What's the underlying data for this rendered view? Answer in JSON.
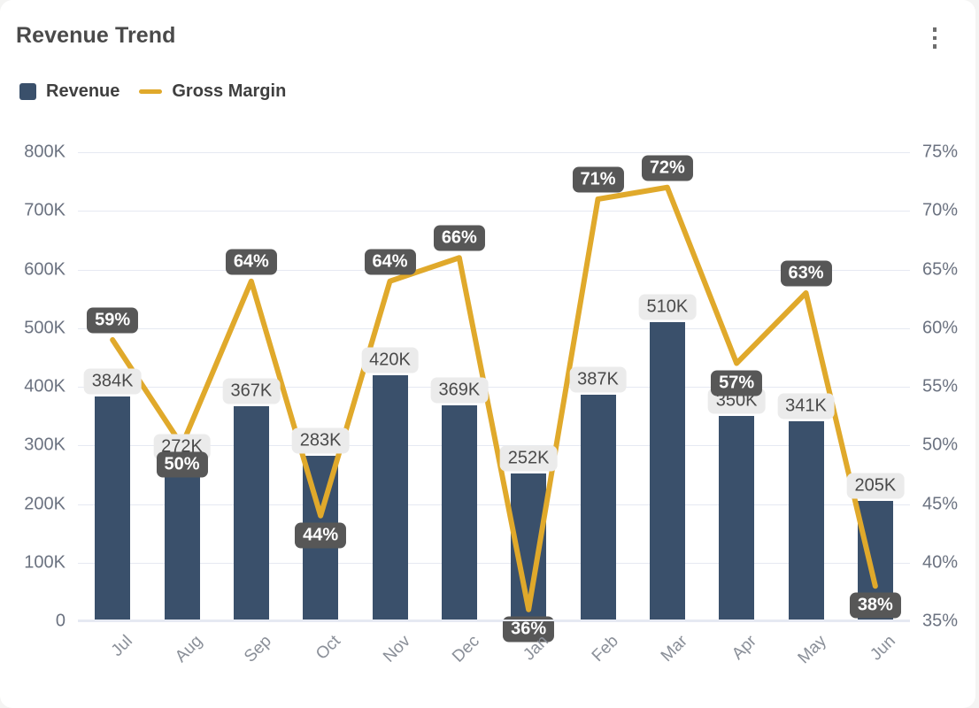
{
  "header": {
    "title": "Revenue Trend",
    "menu_icon": "kebab-menu-icon"
  },
  "legend": {
    "position": "top-left",
    "items": [
      {
        "label": "Revenue",
        "color": "#3a506b",
        "marker": "square"
      },
      {
        "label": "Gross Margin",
        "color": "#e0a92b",
        "marker": "line"
      }
    ]
  },
  "chart_data": {
    "type": "bar",
    "title": "Revenue Trend",
    "xlabel": "",
    "ylabel": "",
    "grid": true,
    "categories": [
      "Jul",
      "Aug",
      "Sep",
      "Oct",
      "Nov",
      "Dec",
      "Jan",
      "Feb",
      "Mar",
      "Apr",
      "May",
      "Jun"
    ],
    "series": [
      {
        "name": "Revenue",
        "type": "bar",
        "axis": "left",
        "color": "#3a506b",
        "values": [
          384000,
          272000,
          367000,
          283000,
          420000,
          369000,
          252000,
          387000,
          510000,
          350000,
          341000,
          205000
        ],
        "labels": [
          "384K",
          "272K",
          "367K",
          "283K",
          "420K",
          "369K",
          "252K",
          "387K",
          "510K",
          "350K",
          "341K",
          "205K"
        ]
      },
      {
        "name": "Gross Margin",
        "type": "line",
        "axis": "right",
        "color": "#e0a92b",
        "values": [
          59,
          50,
          64,
          44,
          64,
          66,
          36,
          71,
          72,
          57,
          63,
          38
        ],
        "labels": [
          "59%",
          "50%",
          "64%",
          "44%",
          "64%",
          "66%",
          "36%",
          "71%",
          "72%",
          "57%",
          "63%",
          "38%"
        ]
      }
    ],
    "left_axis": {
      "ylim": [
        0,
        800000
      ],
      "ticks": [
        0,
        100000,
        200000,
        300000,
        400000,
        500000,
        600000,
        700000,
        800000
      ],
      "tick_labels": [
        "0",
        "100K",
        "200K",
        "300K",
        "400K",
        "500K",
        "600K",
        "700K",
        "800K"
      ]
    },
    "right_axis": {
      "ylim": [
        35,
        75
      ],
      "ticks": [
        35,
        40,
        45,
        50,
        55,
        60,
        65,
        70,
        75
      ],
      "tick_labels": [
        "35%",
        "40%",
        "45%",
        "50%",
        "55%",
        "60%",
        "65%",
        "70%",
        "75%"
      ]
    }
  },
  "colors": {
    "bar": "#3a506b",
    "line": "#e0a92b",
    "grid": "#e6e9f2",
    "bar_label_bg": "#ebebeb",
    "pct_label_bg": "#575757",
    "card_bg": "#ffffff",
    "page_bg": "#f4f4f3"
  }
}
